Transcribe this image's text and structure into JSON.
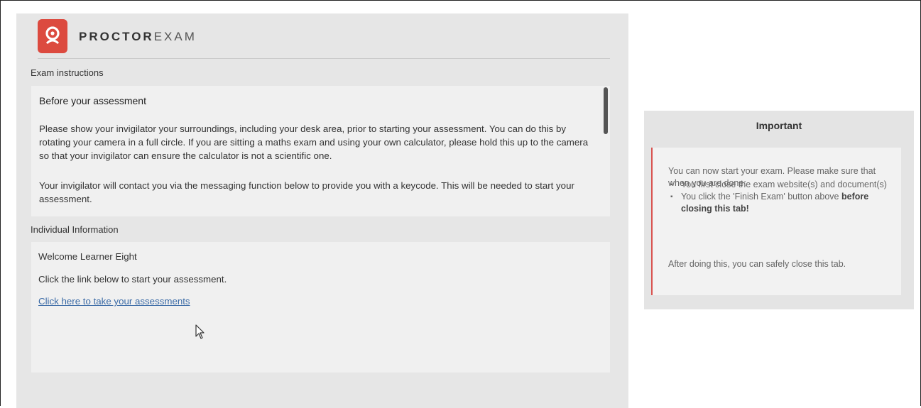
{
  "brand": {
    "name_bold": "PROCTOR",
    "name_light": "EXAM",
    "logo_icon": "proctor-logo-icon",
    "accent_color": "#dc4a3f"
  },
  "instructions": {
    "section_label": "Exam instructions",
    "title": "Before your assessment",
    "paragraph1": "Please show your invigilator your surroundings, including your desk area, prior to starting your assessment. You can do this by rotating your camera in a full circle. If you are sitting a maths exam and using your own calculator, please hold this up to the camera so that your invigilator can ensure the calculator is not a scientific one.",
    "paragraph2": "Your invigilator will contact you via the messaging function below to provide you with a keycode. This will be needed to start your assessment."
  },
  "individual": {
    "section_label": "Individual Information",
    "welcome": "Welcome Learner Eight",
    "prompt": "Click the link below to start your assessment.",
    "link_label": "Click here to take your assessments"
  },
  "important": {
    "title": "Important",
    "intro": "You can now start your exam. Please make sure that when you are done:",
    "items": [
      "You first close the exam website(s) and document(s)",
      "You click the 'Finish Exam' button above"
    ],
    "items_bold_suffix": "before closing this tab!",
    "outro": "After doing this, you can safely close this tab.",
    "border_color": "#d9534f"
  }
}
